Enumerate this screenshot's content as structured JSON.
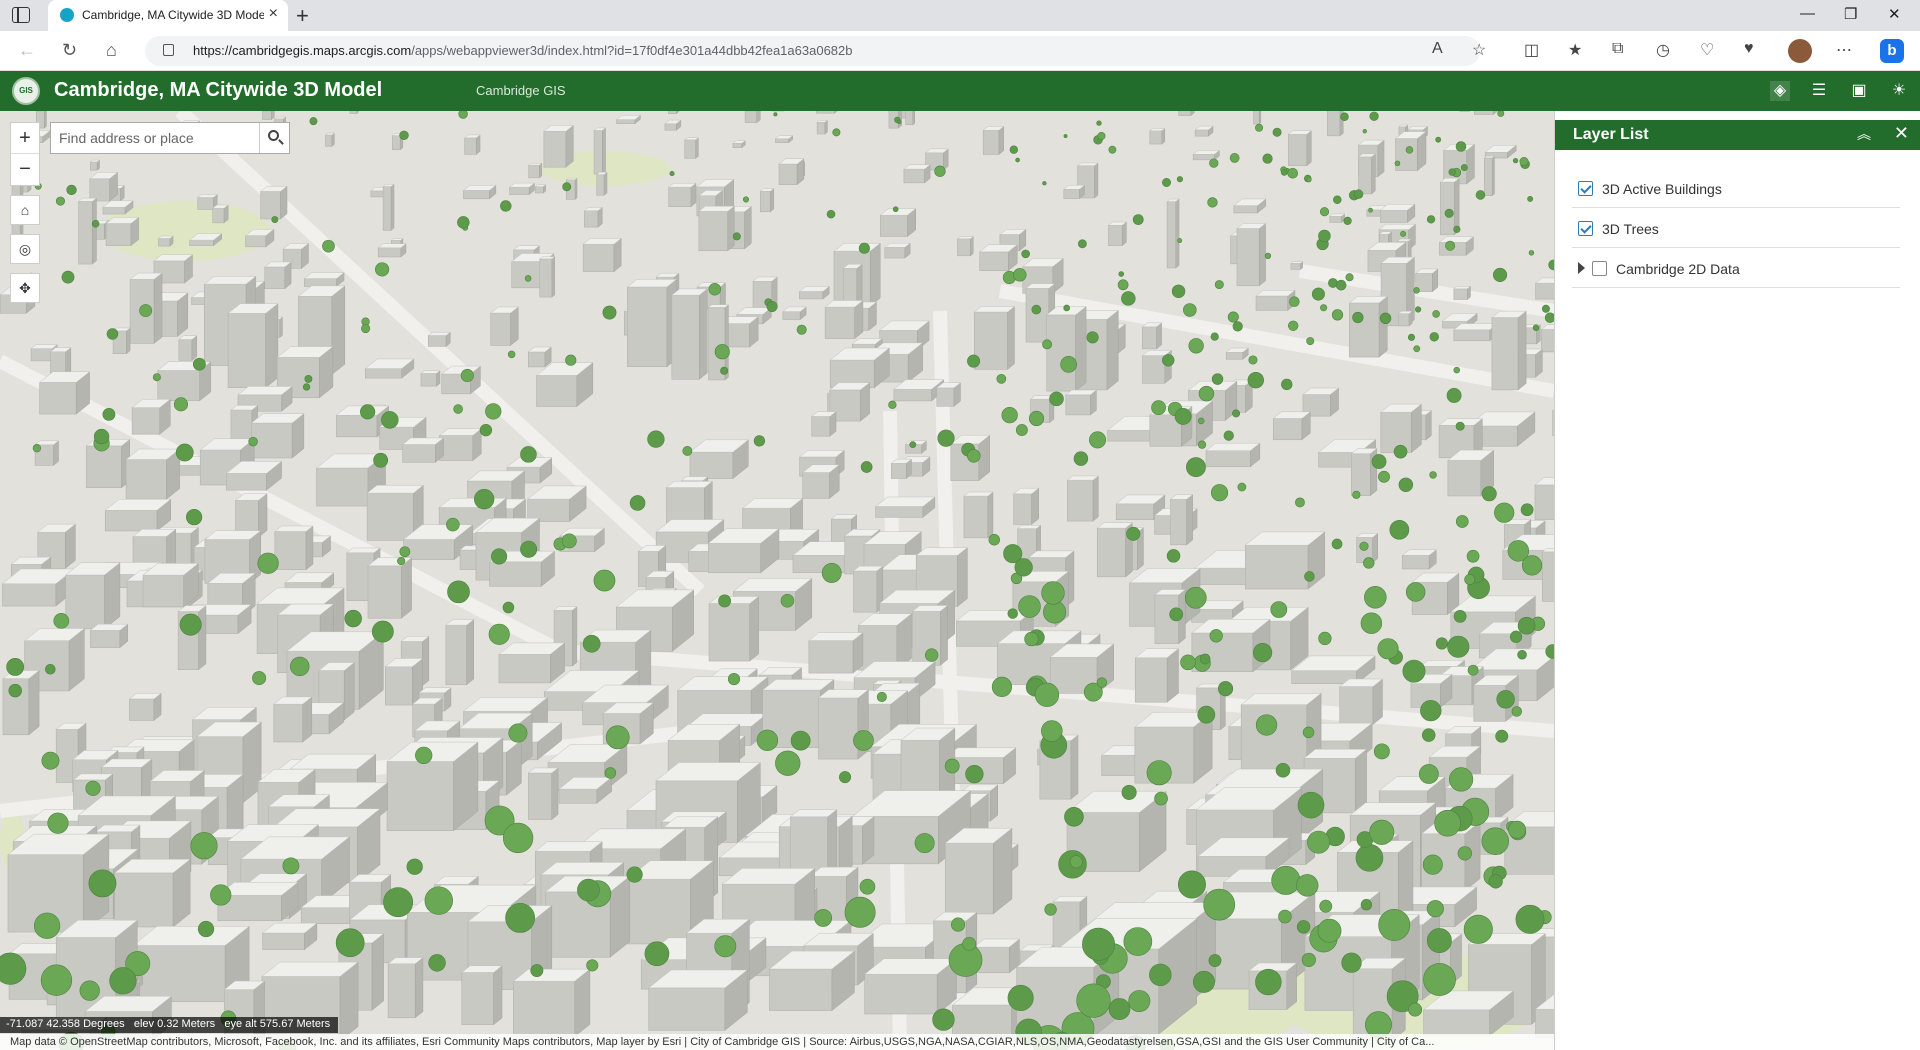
{
  "browser": {
    "tab_title": "Cambridge, MA Citywide 3D Model",
    "url_host": "https://cambridgegis.maps.arcgis.com",
    "url_path": "/apps/webappviewer3d/index.html?id=17f0df4e301a44dbb42fea1a63a0682b"
  },
  "app": {
    "title": "Cambridge, MA Citywide 3D Model",
    "subtitle": "Cambridge GIS",
    "logo_text": "GIS",
    "brand_color": "#236d2c"
  },
  "map": {
    "search_placeholder": "Find address or place",
    "zoom_in": "+",
    "zoom_out": "−",
    "coords": "-71.087 42.358 Degrees",
    "elev": "elev 0.32 Meters",
    "eye_alt": "eye alt 575.67 Meters",
    "attribution": "Map data © OpenStreetMap contributors, Microsoft, Facebook, Inc. and its affiliates, Esri Community Maps contributors, Map layer by Esri | City of Cambridge GIS | Source: Airbus,USGS,NGA,NASA,CGIAR,NLS,OS,NMA,Geodatastyrelsen,GSA,GSI and the GIS User Community | City of Ca..."
  },
  "layer_list": {
    "title": "Layer List",
    "layers": [
      {
        "label": "3D Active Buildings",
        "checked": true
      },
      {
        "label": "3D Trees",
        "checked": true
      },
      {
        "label": "Cambridge 2D Data",
        "checked": false
      }
    ]
  }
}
